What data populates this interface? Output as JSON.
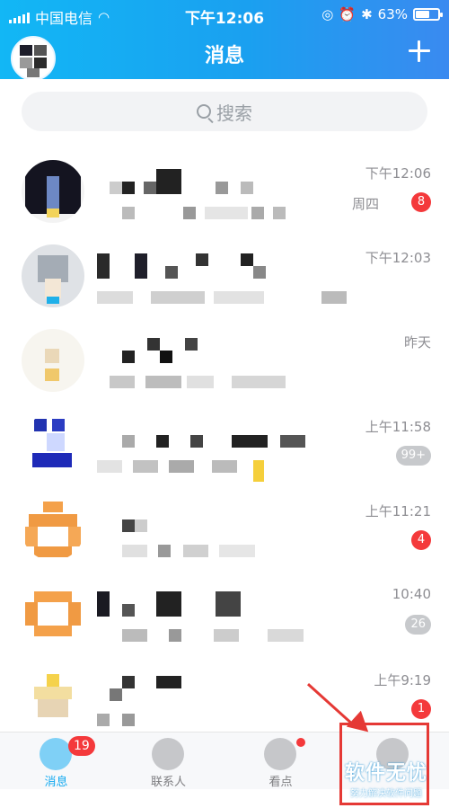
{
  "status_bar": {
    "carrier": "中国电信",
    "time": "下午12:06",
    "battery": "63%",
    "battery_level": 0.63
  },
  "header": {
    "title": "消息",
    "add_icon": "plus-icon"
  },
  "search": {
    "placeholder": "搜索"
  },
  "conversations": [
    {
      "time": "下午12:06",
      "preview_tail": "周四",
      "badge": "8",
      "badge_style": "red"
    },
    {
      "time": "下午12:03",
      "preview_tail": "",
      "badge": "",
      "badge_style": ""
    },
    {
      "time": "昨天",
      "preview_tail": "",
      "badge": "",
      "badge_style": ""
    },
    {
      "time": "上午11:58",
      "preview_tail": "",
      "badge": "99+",
      "badge_style": "grey"
    },
    {
      "time": "上午11:21",
      "preview_tail": "",
      "badge": "4",
      "badge_style": "red"
    },
    {
      "time": "10:40",
      "preview_tail": "",
      "badge": "26",
      "badge_style": "grey"
    },
    {
      "time": "上午9:19",
      "preview_tail": "",
      "badge": "1",
      "badge_style": "red"
    }
  ],
  "tabbar": {
    "tabs": [
      {
        "label": "消息",
        "badge": "19",
        "active": true,
        "icon": "chat-bubble-icon"
      },
      {
        "label": "联系人",
        "badge": "",
        "active": false,
        "icon": "contacts-icon"
      },
      {
        "label": "看点",
        "badge": "",
        "active": false,
        "icon": "eye-icon"
      },
      {
        "label": "",
        "badge": "",
        "active": false,
        "icon": "star-icon"
      }
    ]
  },
  "watermark": {
    "title": "软件无忧",
    "subtitle": "努力解决软件问题"
  },
  "colors": {
    "header_start": "#12b7f5",
    "header_end": "#3a8af0",
    "badge_red": "#f4393b",
    "highlight_red": "#e53935",
    "active_tab": "#12a9f0"
  }
}
